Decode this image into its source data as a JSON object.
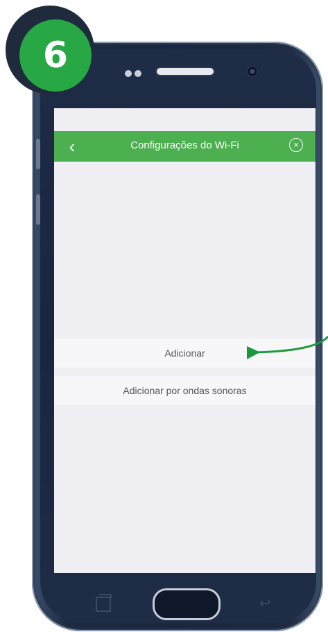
{
  "step_badge": {
    "number": "6"
  },
  "appbar": {
    "title": "Configurações do Wi-Fi",
    "back_icon": "chevron-left-icon",
    "close_icon": "circle-x-icon"
  },
  "list": {
    "items": [
      {
        "label": "Adicionar"
      },
      {
        "label": "Adicionar por ondas sonoras"
      }
    ]
  },
  "colors": {
    "appbar_bg": "#4caf50",
    "screen_bg": "#efeff4",
    "badge_green": "#27a844",
    "arrow_green": "#1a9a3a"
  },
  "device": {
    "nav_icons": [
      "recent-apps-icon",
      "home-button",
      "back-icon"
    ]
  }
}
